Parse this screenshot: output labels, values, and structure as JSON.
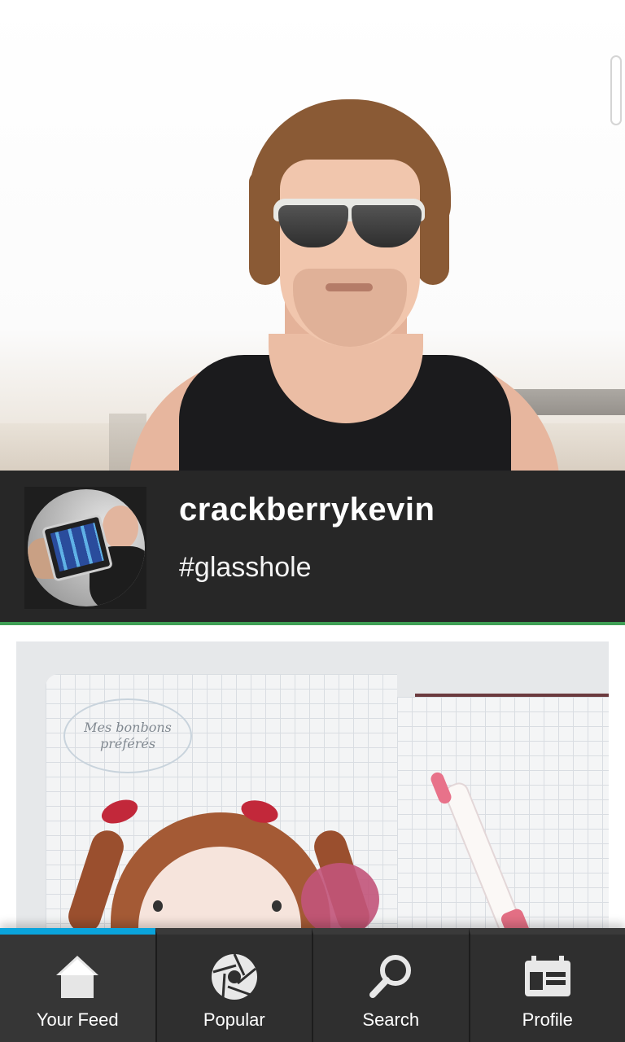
{
  "feed": {
    "posts": [
      {
        "username": "crackberrykevin",
        "caption": "#glasshole",
        "accent_color": "#3f9f55"
      },
      {
        "photo_text": "Mes bonbons préférés"
      }
    ]
  },
  "bottom_nav": {
    "active_tab": "Your Feed",
    "active_color": "#0aa4dc",
    "tabs": [
      {
        "label": "Your Feed",
        "icon": "home-icon"
      },
      {
        "label": "Popular",
        "icon": "aperture-icon"
      },
      {
        "label": "Search",
        "icon": "search-icon"
      },
      {
        "label": "Profile",
        "icon": "calendar-card-icon"
      }
    ]
  }
}
